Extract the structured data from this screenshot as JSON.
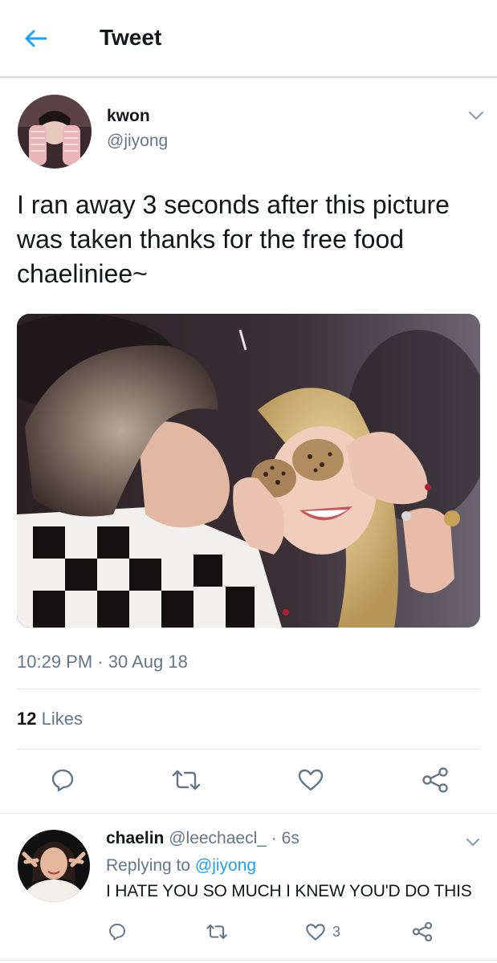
{
  "header": {
    "title": "Tweet",
    "back_icon": "arrow-left-icon"
  },
  "tweet": {
    "author_name": "kwon",
    "author_handle": "@jiyong",
    "text": "I ran away 3 seconds after this picture was taken thanks for the free food chaeliniee~",
    "time": "10:29 PM",
    "separator": "·",
    "date": "30 Aug 18",
    "likes_count": "12",
    "likes_label": "Likes",
    "media_alt": "photo",
    "actions": [
      "reply-icon",
      "retweet-icon",
      "like-icon",
      "share-icon"
    ]
  },
  "reply": {
    "author_name": "chaelin",
    "author_handle": "@leechaecl_",
    "separator": "·",
    "time": "6s",
    "replying_label": "Replying to",
    "replying_to": "@jiyong",
    "text": "I HATE YOU SO MUCH I KNEW YOU'D DO THIS",
    "like_count": "3"
  },
  "colors": {
    "accent": "#1da1f2",
    "secondary_text": "#657786",
    "primary_text": "#14171a",
    "divider": "#e1e8ed"
  }
}
